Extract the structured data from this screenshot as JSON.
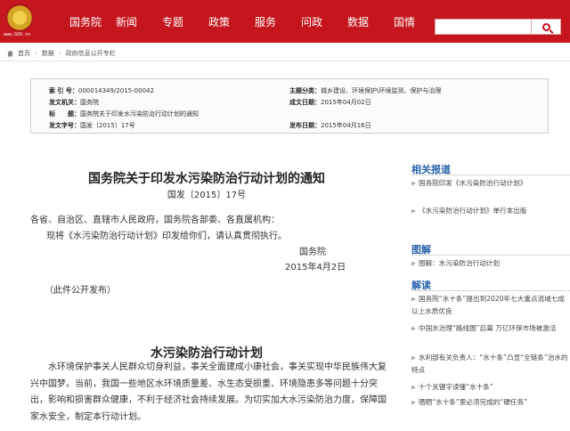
{
  "header": {
    "logo_text": "www.GOV.cn",
    "nav": [
      "国务院",
      "新闻",
      "专题",
      "政策",
      "服务",
      "问政",
      "数据",
      "国情"
    ]
  },
  "breadcrumb": [
    "首页",
    "数据",
    "政府信息公开专栏"
  ],
  "meta": {
    "index_no_label": "索 引 号：",
    "index_no": "000014349/2015-00042",
    "category_label": "主题分类：",
    "category": "城乡建设、环境保护\\环境监测、保护与治理",
    "issuer_label": "发文机关：",
    "issuer": "国务院",
    "created_label": "成文日期：",
    "created": "2015年04月02日",
    "title_label": "标　　题：",
    "title": "国务院关于印发水污染防治行动计划的通知",
    "docno_label": "发文字号：",
    "docno": "国发〔2015〕17号",
    "published_label": "发布日期：",
    "published": "2015年04月16日"
  },
  "article": {
    "title": "国务院关于印发水污染防治行动计划的通知",
    "doc_no": "国发〔2015〕17号",
    "addressee": "各省、自治区、直辖市人民政府，国务院各部委、各直属机构：",
    "body": "现将《水污染防治行动计划》印发给你们，请认真贯彻执行。",
    "signer": "国务院",
    "date": "2015年4月2日",
    "note": "（此件公开发布）",
    "subtitle": "水污染防治行动计划",
    "paragraph": "水环境保护事关人民群众切身利益，事关全面建成小康社会，事关实现中华民族伟大复兴中国梦。当前，我国一些地区水环境质量差、水生态受损重、环境隐患多等问题十分突出，影响和损害群众健康，不利于经济社会持续发展。为切实加大水污染防治力度，保障国家水安全，制定本行动计划。"
  },
  "sidebar": {
    "related_title": "相关报道",
    "related": [
      "国务院印发《水污染防治行动计划》",
      "《水污染防治行动计划》单行本出版"
    ],
    "diagram_title": "图解",
    "diagram": [
      "图解：水污染防治行动计划"
    ],
    "explain_title": "解读",
    "explain": [
      "国务院“水十条”提出到2020年七大重点流域七成以上水质优良",
      "中国水治理“路线图”启幕 万亿环保市场被激活",
      "水利部有关负责人：“水十条”凸显“全链条”治水的特点",
      "十个关键字读懂“水十条”",
      "晒晒“水十条”里必须完成的“硬任务”"
    ]
  }
}
